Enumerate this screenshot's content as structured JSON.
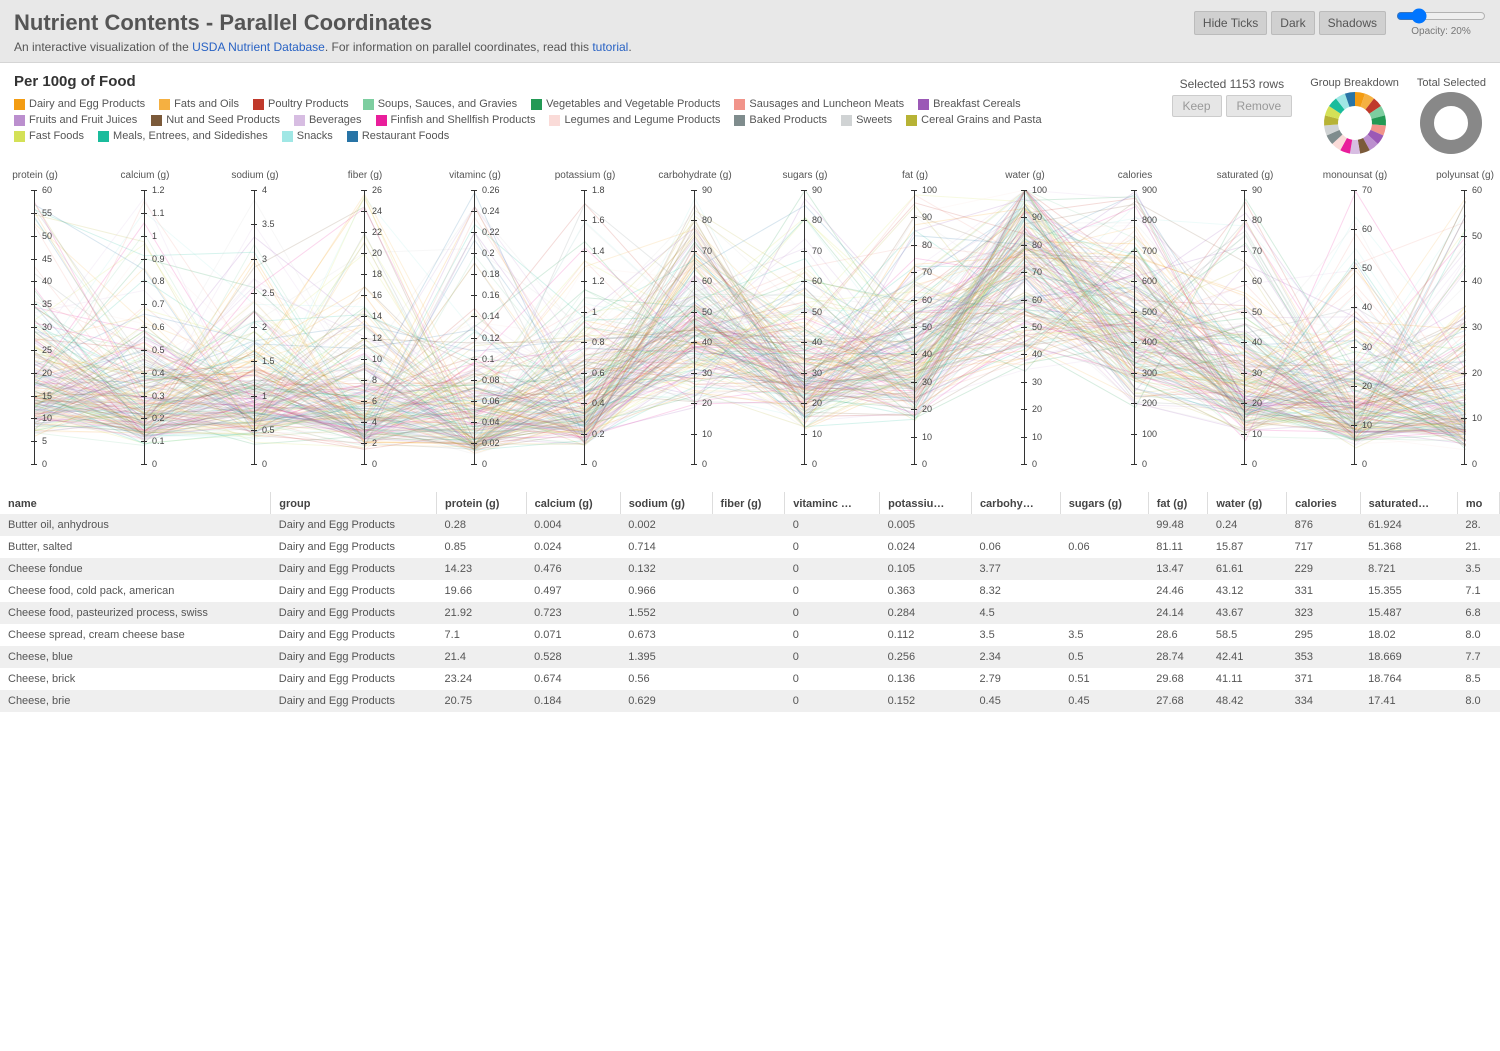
{
  "header": {
    "title": "Nutrient Contents - Parallel Coordinates",
    "subtitle_pre": "An interactive visualization of the ",
    "link1": "USDA Nutrient Database",
    "subtitle_mid": ". For information on parallel coordinates, read this ",
    "link2": "tutorial",
    "subtitle_post": "."
  },
  "toolbar": {
    "hide_ticks": "Hide Ticks",
    "dark": "Dark",
    "shadows": "Shadows",
    "opacity_label": "Opacity: 20%",
    "opacity_value": 20
  },
  "section_title": "Per 100g of Food",
  "selection": {
    "text": "Selected 1153 rows",
    "keep": "Keep",
    "remove": "Remove",
    "group_breakdown": "Group Breakdown",
    "total_selected": "Total Selected"
  },
  "legend": [
    {
      "name": "Dairy and Egg Products",
      "color": "#f39c12"
    },
    {
      "name": "Fats and Oils",
      "color": "#f5b041"
    },
    {
      "name": "Poultry Products",
      "color": "#c0392b"
    },
    {
      "name": "Soups, Sauces, and Gravies",
      "color": "#7dcea0"
    },
    {
      "name": "Vegetables and Vegetable Products",
      "color": "#229954"
    },
    {
      "name": "Sausages and Luncheon Meats",
      "color": "#f1948a"
    },
    {
      "name": "Breakfast Cereals",
      "color": "#9b59b6"
    },
    {
      "name": "Fruits and Fruit Juices",
      "color": "#bb8fce"
    },
    {
      "name": "Nut and Seed Products",
      "color": "#7b5a3a"
    },
    {
      "name": "Beverages",
      "color": "#d7bde2"
    },
    {
      "name": "Finfish and Shellfish Products",
      "color": "#e91e9b"
    },
    {
      "name": "Legumes and Legume Products",
      "color": "#fadbd8"
    },
    {
      "name": "Baked Products",
      "color": "#7f8c8d"
    },
    {
      "name": "Sweets",
      "color": "#d0d3d4"
    },
    {
      "name": "Cereal Grains and Pasta",
      "color": "#b7b335"
    },
    {
      "name": "Fast Foods",
      "color": "#d4e157"
    },
    {
      "name": "Meals, Entrees, and Sidedishes",
      "color": "#1abc9c"
    },
    {
      "name": "Snacks",
      "color": "#a0e7e5"
    },
    {
      "name": "Restaurant Foods",
      "color": "#2874a6"
    }
  ],
  "chart_data": {
    "type": "parallel-coordinates",
    "opacity": 0.2,
    "n_lines_represented": 1153,
    "axes": [
      {
        "label": "protein (g)",
        "min": 0,
        "max": 60,
        "ticks": [
          0,
          5,
          10,
          15,
          20,
          25,
          30,
          35,
          40,
          45,
          50,
          55,
          60
        ]
      },
      {
        "label": "calcium (g)",
        "min": 0.0,
        "max": 1.2,
        "ticks": [
          0.0,
          0.1,
          0.2,
          0.3,
          0.4,
          0.5,
          0.6,
          0.7,
          0.8,
          0.9,
          1.0,
          1.1,
          1.2
        ]
      },
      {
        "label": "sodium (g)",
        "min": 0.0,
        "max": 4.0,
        "ticks": [
          0.0,
          0.5,
          1.0,
          1.5,
          2.0,
          2.5,
          3.0,
          3.5,
          4.0
        ]
      },
      {
        "label": "fiber (g)",
        "min": 0,
        "max": 26,
        "ticks": [
          0,
          2,
          4,
          6,
          8,
          10,
          12,
          14,
          16,
          18,
          20,
          22,
          24,
          26
        ]
      },
      {
        "label": "vitaminc (g)",
        "min": 0.0,
        "max": 0.26,
        "ticks": [
          0.0,
          0.02,
          0.04,
          0.06,
          0.08,
          0.1,
          0.12,
          0.14,
          0.16,
          0.18,
          0.2,
          0.22,
          0.24,
          0.26
        ]
      },
      {
        "label": "potassium (g)",
        "min": 0.0,
        "max": 1.8,
        "ticks": [
          0.0,
          0.2,
          0.4,
          0.6,
          0.8,
          1.0,
          1.2,
          1.4,
          1.6,
          1.8
        ]
      },
      {
        "label": "carbohydrate (g)",
        "min": 0,
        "max": 90,
        "ticks": [
          0,
          10,
          20,
          30,
          40,
          50,
          60,
          70,
          80,
          90
        ]
      },
      {
        "label": "sugars (g)",
        "min": 0,
        "max": 90,
        "ticks": [
          0,
          10,
          20,
          30,
          40,
          50,
          60,
          70,
          80,
          90
        ]
      },
      {
        "label": "fat (g)",
        "min": 0,
        "max": 100,
        "ticks": [
          0,
          10,
          20,
          30,
          40,
          50,
          60,
          70,
          80,
          90,
          100
        ]
      },
      {
        "label": "water (g)",
        "min": 0,
        "max": 100,
        "ticks": [
          0,
          10,
          20,
          30,
          40,
          50,
          60,
          70,
          80,
          90,
          100
        ]
      },
      {
        "label": "calories",
        "min": 0,
        "max": 900,
        "ticks": [
          0,
          100,
          200,
          300,
          400,
          500,
          600,
          700,
          800,
          900
        ]
      },
      {
        "label": "saturated (g)",
        "min": 0,
        "max": 90,
        "ticks": [
          0,
          10,
          20,
          30,
          40,
          50,
          60,
          70,
          80,
          90
        ]
      },
      {
        "label": "monounsat (g)",
        "min": 0,
        "max": 70,
        "ticks": [
          0,
          10,
          20,
          30,
          40,
          50,
          60,
          70
        ]
      },
      {
        "label": "polyunsat (g)",
        "min": 0,
        "max": 60,
        "ticks": [
          0,
          10,
          20,
          30,
          40,
          50,
          60
        ]
      }
    ]
  },
  "table": {
    "columns": [
      "name",
      "group",
      "protein (g)",
      "calcium (g)",
      "sodium (g)",
      "fiber (g)",
      "vitaminc …",
      "potassiu…",
      "carbohy…",
      "sugars (g)",
      "fat (g)",
      "water (g)",
      "calories",
      "saturated…",
      "mo"
    ],
    "rows": [
      [
        "Butter oil, anhydrous",
        "Dairy and Egg Products",
        "0.28",
        "0.004",
        "0.002",
        "",
        "0",
        "0.005",
        "",
        "",
        "99.48",
        "0.24",
        "876",
        "61.924",
        "28."
      ],
      [
        "Butter, salted",
        "Dairy and Egg Products",
        "0.85",
        "0.024",
        "0.714",
        "",
        "0",
        "0.024",
        "0.06",
        "0.06",
        "81.11",
        "15.87",
        "717",
        "51.368",
        "21."
      ],
      [
        "Cheese fondue",
        "Dairy and Egg Products",
        "14.23",
        "0.476",
        "0.132",
        "",
        "0",
        "0.105",
        "3.77",
        "",
        "13.47",
        "61.61",
        "229",
        "8.721",
        "3.5"
      ],
      [
        "Cheese food, cold pack, american",
        "Dairy and Egg Products",
        "19.66",
        "0.497",
        "0.966",
        "",
        "0",
        "0.363",
        "8.32",
        "",
        "24.46",
        "43.12",
        "331",
        "15.355",
        "7.1"
      ],
      [
        "Cheese food, pasteurized process, swiss",
        "Dairy and Egg Products",
        "21.92",
        "0.723",
        "1.552",
        "",
        "0",
        "0.284",
        "4.5",
        "",
        "24.14",
        "43.67",
        "323",
        "15.487",
        "6.8"
      ],
      [
        "Cheese spread, cream cheese base",
        "Dairy and Egg Products",
        "7.1",
        "0.071",
        "0.673",
        "",
        "0",
        "0.112",
        "3.5",
        "3.5",
        "28.6",
        "58.5",
        "295",
        "18.02",
        "8.0"
      ],
      [
        "Cheese, blue",
        "Dairy and Egg Products",
        "21.4",
        "0.528",
        "1.395",
        "",
        "0",
        "0.256",
        "2.34",
        "0.5",
        "28.74",
        "42.41",
        "353",
        "18.669",
        "7.7"
      ],
      [
        "Cheese, brick",
        "Dairy and Egg Products",
        "23.24",
        "0.674",
        "0.56",
        "",
        "0",
        "0.136",
        "2.79",
        "0.51",
        "29.68",
        "41.11",
        "371",
        "18.764",
        "8.5"
      ],
      [
        "Cheese, brie",
        "Dairy and Egg Products",
        "20.75",
        "0.184",
        "0.629",
        "",
        "0",
        "0.152",
        "0.45",
        "0.45",
        "27.68",
        "48.42",
        "334",
        "17.41",
        "8.0"
      ]
    ]
  }
}
